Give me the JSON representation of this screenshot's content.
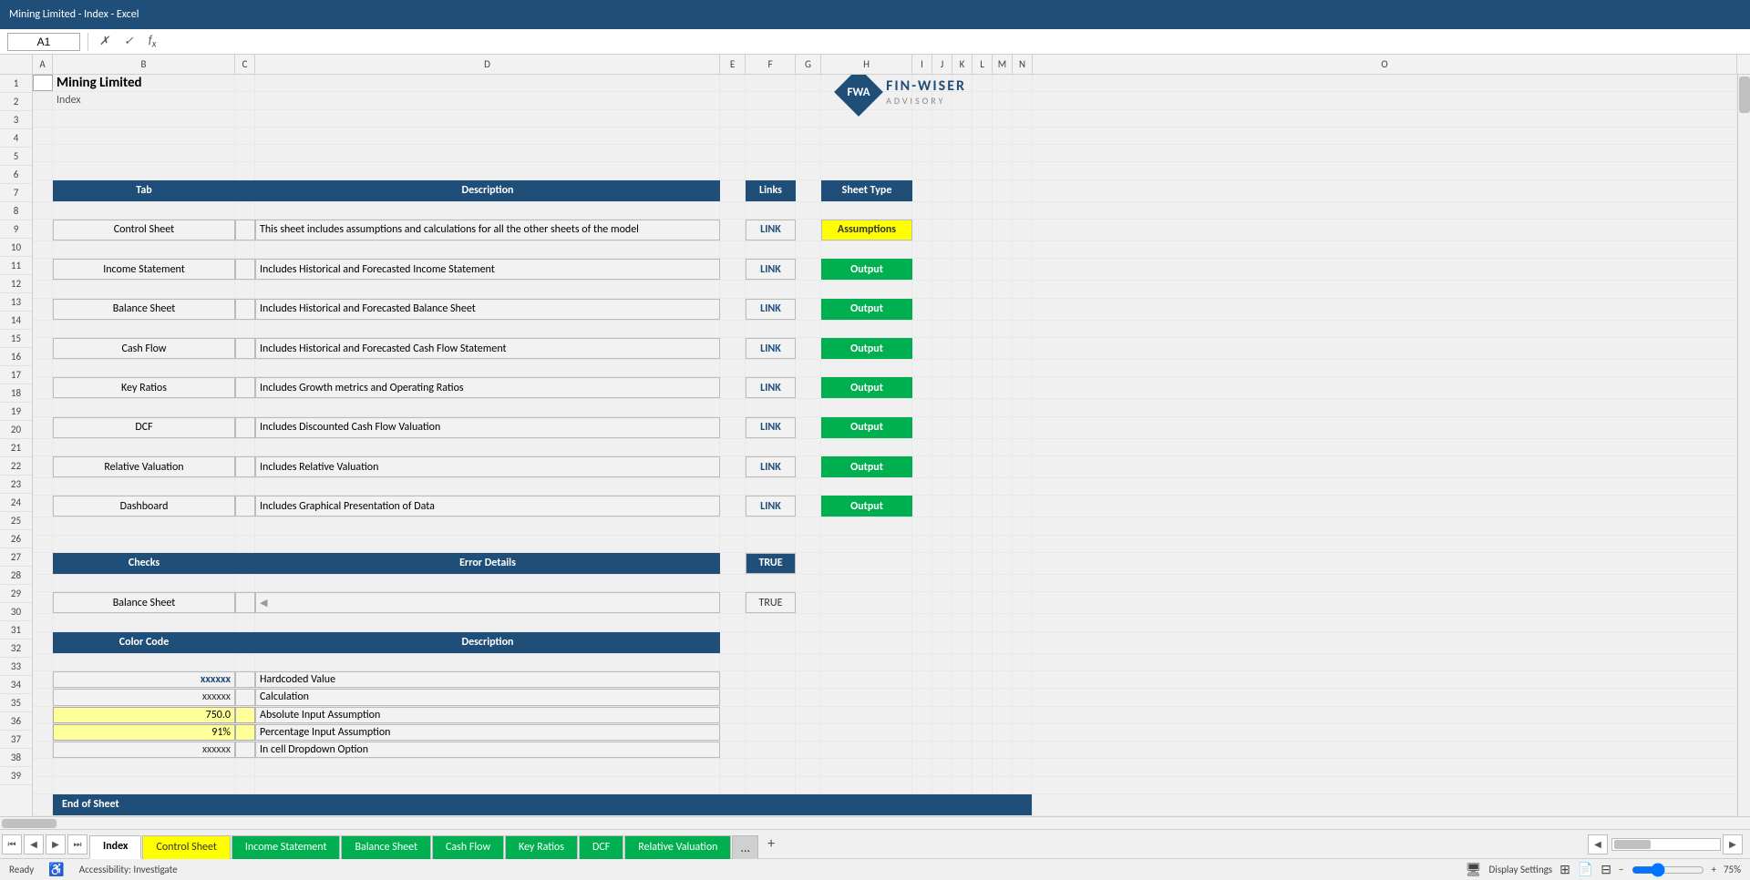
{
  "titleBar": {
    "text": "Mining Limited - Index - Excel"
  },
  "formulaBar": {
    "cellRef": "A1",
    "formula": ""
  },
  "spreadsheet": {
    "title": "Mining Limited",
    "subtitle": "Index",
    "columns": [
      "A",
      "B",
      "C",
      "D",
      "E",
      "F",
      "G",
      "H",
      "I",
      "J",
      "K",
      "L",
      "M",
      "N",
      "O"
    ],
    "headers": {
      "tab": "Tab",
      "description": "Description",
      "links": "Links",
      "sheetType": "Sheet Type"
    },
    "tableRows": [
      {
        "tab": "Control Sheet",
        "description": "This sheet includes assumptions and calculations for all the other sheets of the model",
        "link": "LINK",
        "type": "Assumptions",
        "typeClass": "assumptions"
      },
      {
        "tab": "Income Statement",
        "description": "Includes Historical and Forecasted Income Statement",
        "link": "LINK",
        "type": "Output",
        "typeClass": "output"
      },
      {
        "tab": "Balance Sheet",
        "description": "Includes Historical and Forecasted Balance Sheet",
        "link": "LINK",
        "type": "Output",
        "typeClass": "output"
      },
      {
        "tab": "Cash Flow",
        "description": "Includes Historical and Forecasted Cash Flow Statement",
        "link": "LINK",
        "type": "Output",
        "typeClass": "output"
      },
      {
        "tab": "Key Ratios",
        "description": "Includes Growth metrics and Operating Ratios",
        "link": "LINK",
        "type": "Output",
        "typeClass": "output"
      },
      {
        "tab": "DCF",
        "description": "Includes Discounted Cash Flow Valuation",
        "link": "LINK",
        "type": "Output",
        "typeClass": "output"
      },
      {
        "tab": "Relative Valuation",
        "description": "Includes Relative Valuation",
        "link": "LINK",
        "type": "Output",
        "typeClass": "output"
      },
      {
        "tab": "Dashboard",
        "description": "Includes Graphical Presentation of Data",
        "link": "LINK",
        "type": "Output",
        "typeClass": "output"
      }
    ],
    "checksHeader": {
      "checks": "Checks",
      "errorDetails": "Error Details",
      "status": "TRUE"
    },
    "checksRows": [
      {
        "name": "Balance Sheet",
        "error": "",
        "status": "TRUE"
      }
    ],
    "colorHeader": {
      "colorCode": "Color Code",
      "description": "Description"
    },
    "colorRows": [
      {
        "value": "xxxxxx",
        "description": "Hardcoded Value",
        "style": "blue-text"
      },
      {
        "value": "xxxxxx",
        "description": "Calculation",
        "style": "normal"
      },
      {
        "value": "750.0",
        "description": "Absolute Input Assumption",
        "style": "yellow-input"
      },
      {
        "value": "91%",
        "description": "Percentage Input Assumption",
        "style": "yellow-input"
      },
      {
        "value": "xxxxxx",
        "description": "In cell Dropdown Option",
        "style": "normal"
      }
    ],
    "endOfSheet": "End of Sheet"
  },
  "logo": {
    "initials": "FWA",
    "name": "FIN-WISER",
    "subtitle": "ADVISORY"
  },
  "tabs": [
    {
      "label": "Index",
      "style": "active"
    },
    {
      "label": "Control Sheet",
      "style": "yellow"
    },
    {
      "label": "Income Statement",
      "style": "green"
    },
    {
      "label": "Balance Sheet",
      "style": "green"
    },
    {
      "label": "Cash Flow",
      "style": "green"
    },
    {
      "label": "Key Ratios",
      "style": "green"
    },
    {
      "label": "DCF",
      "style": "green"
    },
    {
      "label": "Relative Valuation",
      "style": "green"
    }
  ],
  "statusBar": {
    "ready": "Ready",
    "accessibility": "Accessibility: Investigate",
    "displaySettings": "Display Settings",
    "zoom": "75%"
  }
}
